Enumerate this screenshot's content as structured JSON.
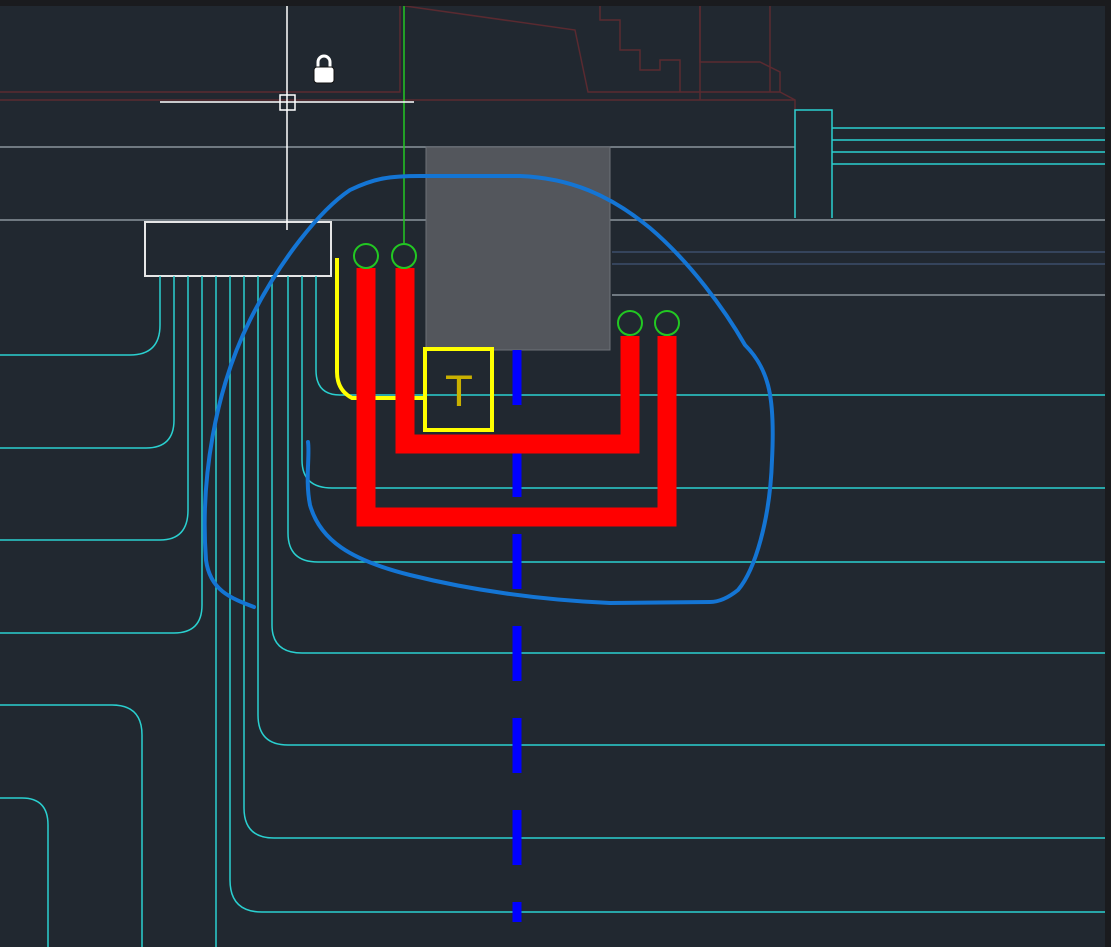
{
  "app": {
    "canvas_type": "cad-drawing-viewport",
    "background": "#212830"
  },
  "colors": {
    "cyan": "#2ad0d0",
    "red": "#ff0000",
    "yellow": "#ffff00",
    "blue_dash": "#0000ff",
    "annotation_blue": "#1475d4",
    "green": "#22c822",
    "grey_block": "#53565c",
    "white": "#ffffff",
    "dark_red": "#5a2a30",
    "steel": "#8a949c"
  },
  "icons": {
    "crosshair": "crosshair-icon",
    "lock": "lock-icon"
  },
  "drawing": {
    "tag_label": "T"
  }
}
